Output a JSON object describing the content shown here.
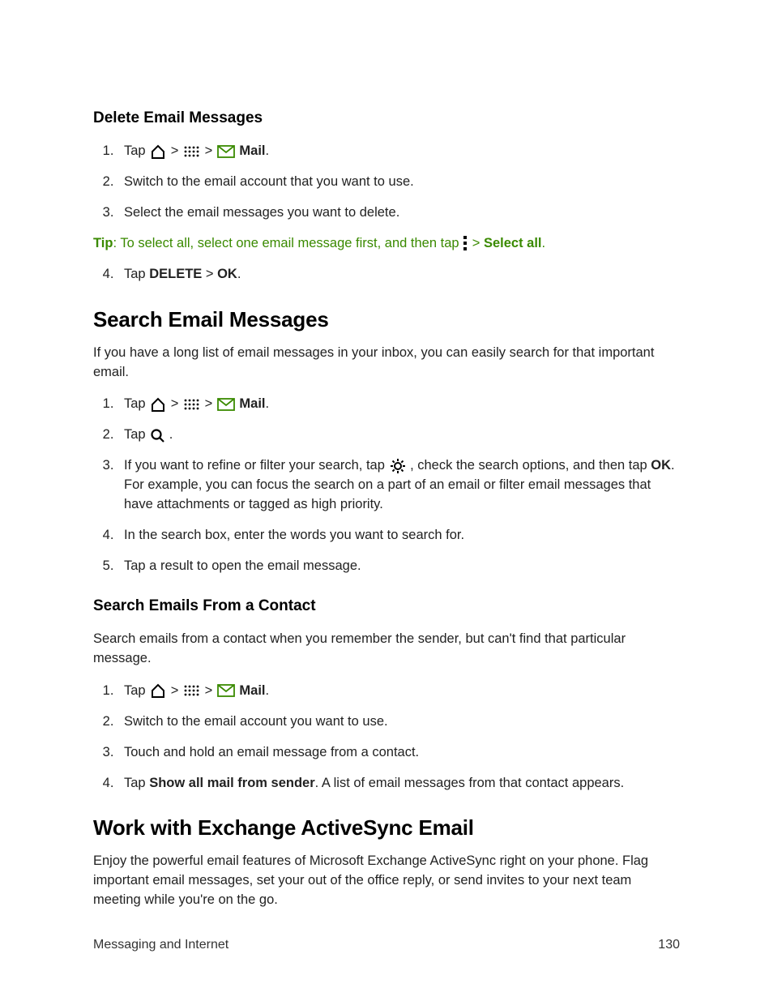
{
  "section1": {
    "heading": "Delete Email Messages",
    "steps": {
      "s1_tap": "Tap ",
      "s1_mail": "Mail",
      "s2": "Switch to the email account that you want to use.",
      "s3": "Select the email messages you want to delete.",
      "s4_pre": "Tap ",
      "s4_delete": "DELETE",
      "s4_gt": " > ",
      "s4_ok": "OK",
      "s4_dot": "."
    },
    "tip": {
      "label": "Tip",
      "text": ": To select all, select one email message first, and then tap ",
      "gt": " > ",
      "select_all": "Select all",
      "dot": "."
    }
  },
  "section2": {
    "heading": "Search Email Messages",
    "intro": "If you have a long list of email messages in your inbox, you can easily search for that important email.",
    "steps": {
      "s1_tap": "Tap ",
      "s1_mail": "Mail",
      "s2_tap": "Tap ",
      "s2_dot": " .",
      "s3_pre": "If you want to refine or filter your search, tap ",
      "s3_mid": " , check the search options, and then tap ",
      "s3_ok": "OK",
      "s3_post": ". For example, you can focus the search on a part of an email or filter email messages that have attachments or tagged as high priority.",
      "s4": "In the search box, enter the words you want to search for.",
      "s5": "Tap a result to open the email message."
    }
  },
  "section3": {
    "heading": "Search Emails From a Contact",
    "intro": "Search emails from a contact when you remember the sender, but can't find that particular message.",
    "steps": {
      "s1_tap": "Tap ",
      "s1_mail": "Mail",
      "s2": "Switch to the email account you want to use.",
      "s3": "Touch and hold an email message from a contact.",
      "s4_pre": "Tap ",
      "s4_bold": "Show all mail from sender",
      "s4_post": ". A list of email messages from that contact appears."
    }
  },
  "section4": {
    "heading": "Work with Exchange ActiveSync Email",
    "intro": "Enjoy the powerful email features of Microsoft Exchange ActiveSync right on your phone. Flag important email messages, set your out of the office reply, or send invites to your next team meeting while you're on the go."
  },
  "footer": {
    "left": "Messaging and Internet",
    "right": "130"
  },
  "glyphs": {
    "gt": " > ",
    "dot": "."
  }
}
